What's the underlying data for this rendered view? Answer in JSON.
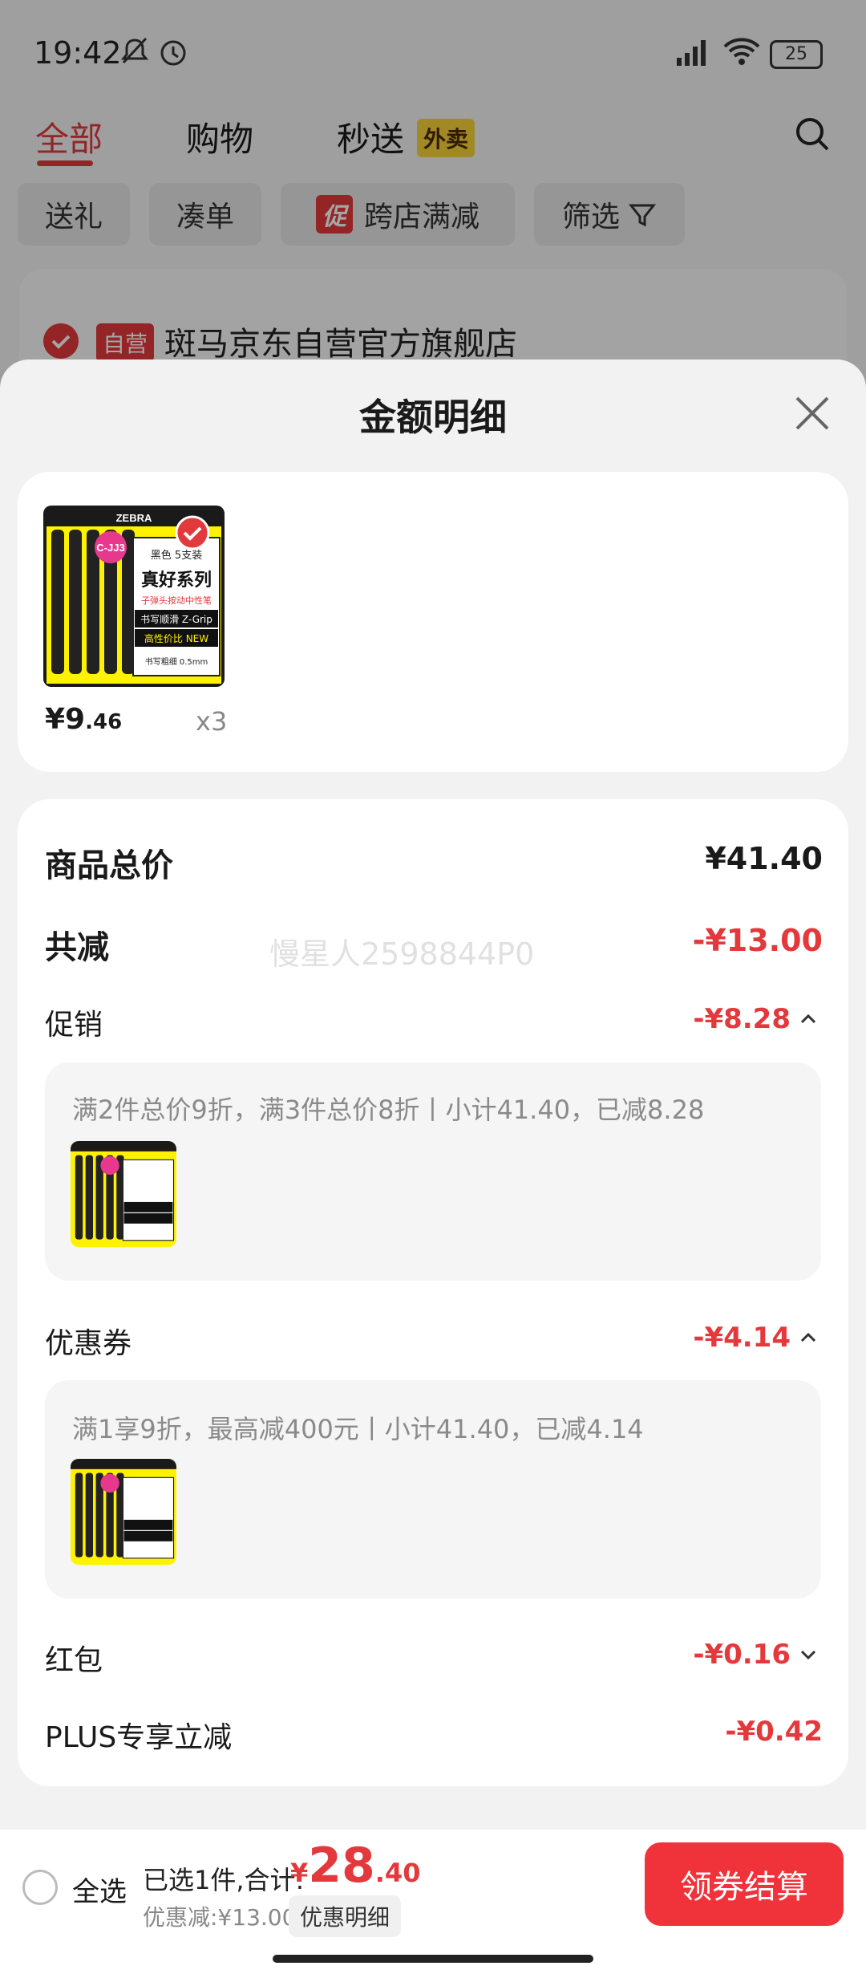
{
  "status_bar": {
    "time": "19:42",
    "battery": "25"
  },
  "tabs": [
    {
      "label": "全部"
    },
    {
      "label": "购物"
    },
    {
      "label": "秒送"
    }
  ],
  "tab_badge": "外卖",
  "filters": [
    {
      "label": "送礼"
    },
    {
      "label": "凑单"
    },
    {
      "label": "跨店满减",
      "tag": "促"
    },
    {
      "label": "筛选"
    }
  ],
  "store": {
    "tag": "自营",
    "name": "斑马京东自营官方旗舰店"
  },
  "sheet": {
    "title": "金额明细",
    "product": {
      "price_int": "¥9",
      "price_dec": ".46",
      "qty": "x3"
    },
    "summary": {
      "total_label": "商品总价",
      "total_value": "¥41.40",
      "reduce_label": "共减",
      "reduce_value": "-¥13.00",
      "watermark": "慢星人2598844P0"
    },
    "promo": {
      "label": "促销",
      "value": "-¥8.28",
      "desc": "满2件总价9折，满3件总价8折丨小计41.40，已减8.28"
    },
    "coupon": {
      "label": "优惠券",
      "value": "-¥4.14",
      "desc": "满1享9折，最高减400元丨小计41.40，已减4.14"
    },
    "redpacket": {
      "label": "红包",
      "value": "-¥0.16"
    },
    "plus": {
      "label": "PLUS专享立减",
      "value": "-¥0.42"
    }
  },
  "product_image": {
    "brand": "ZEBRA",
    "model": "C-JJ3",
    "color_pack": "黑色 5支装",
    "series": "真好系列",
    "subtitle": "子弹头按动中性笔",
    "line1": "书写顺滑 Z-Grip",
    "line2": "高性价比 NEW",
    "line3": "书写粗细 0.5mm"
  },
  "bottom_bar": {
    "select_all": "全选",
    "selected_text": "已选1件,合计:",
    "total_yen": "¥",
    "total_int": "28",
    "total_dec": ".40",
    "discount": "优惠减:¥13.00",
    "detail_btn": "优惠明细",
    "checkout": "领券结算"
  },
  "colors": {
    "accent": "#e4393c",
    "checkout": "#f0323a",
    "badge": "#f8d33a"
  }
}
